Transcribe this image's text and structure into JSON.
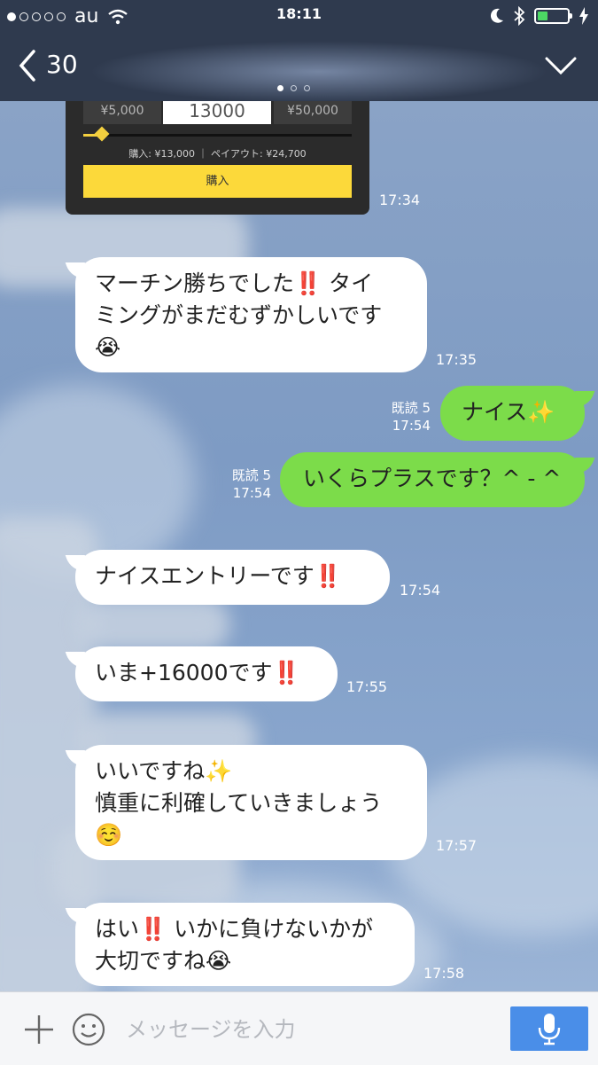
{
  "status_bar": {
    "carrier": "au",
    "time": "18:11",
    "battery_level": 0.35,
    "colors": {
      "battery": "#4cd964"
    }
  },
  "header": {
    "title": "30",
    "icons": [
      "chevron-left-icon",
      "chevron-down-icon"
    ]
  },
  "trade_card": {
    "amount_left": "¥5,000",
    "amount_center": "13000",
    "amount_right": "¥50,000",
    "slider_value": 0.07,
    "summary": "購入: ¥13,000 ｜ ペイアウト: ¥24,700",
    "buy_label": "購入",
    "time": "17:34",
    "colors": {
      "accent": "#fcd93a"
    }
  },
  "messages": [
    {
      "direction": "in",
      "lines": [
        "マーチン勝ちでした‼️ タイ",
        "ミングがまだむずかしいです",
        "😭"
      ],
      "time": "17:35"
    },
    {
      "direction": "out",
      "lines": [
        "ナイス✨"
      ],
      "read": "既読 5",
      "time": "17:54"
    },
    {
      "direction": "out",
      "lines": [
        "いくらプラスです？^ - ^"
      ],
      "read": "既読 5",
      "time": "17:54"
    },
    {
      "direction": "in",
      "lines": [
        "ナイスエントリーです‼️"
      ],
      "time": "17:54"
    },
    {
      "direction": "in",
      "lines": [
        "いま+16000です‼️"
      ],
      "time": "17:55"
    },
    {
      "direction": "in",
      "lines": [
        "いいですね✨",
        "慎重に利確していきましょう",
        "☺️"
      ],
      "time": "17:57"
    },
    {
      "direction": "in",
      "lines": [
        "はい‼️ いかに負けないかが",
        "大切ですね😭"
      ],
      "time": "17:58"
    }
  ],
  "composer": {
    "placeholder": "メッセージを入力",
    "icons": [
      "plus-icon",
      "smile-icon",
      "microphone-icon"
    ],
    "colors": {
      "mic_button": "#4a8ee8"
    }
  },
  "colors": {
    "incoming_bubble": "#ffffff",
    "outgoing_bubble": "#7cdc4a",
    "bar": "#2f3a4e"
  }
}
